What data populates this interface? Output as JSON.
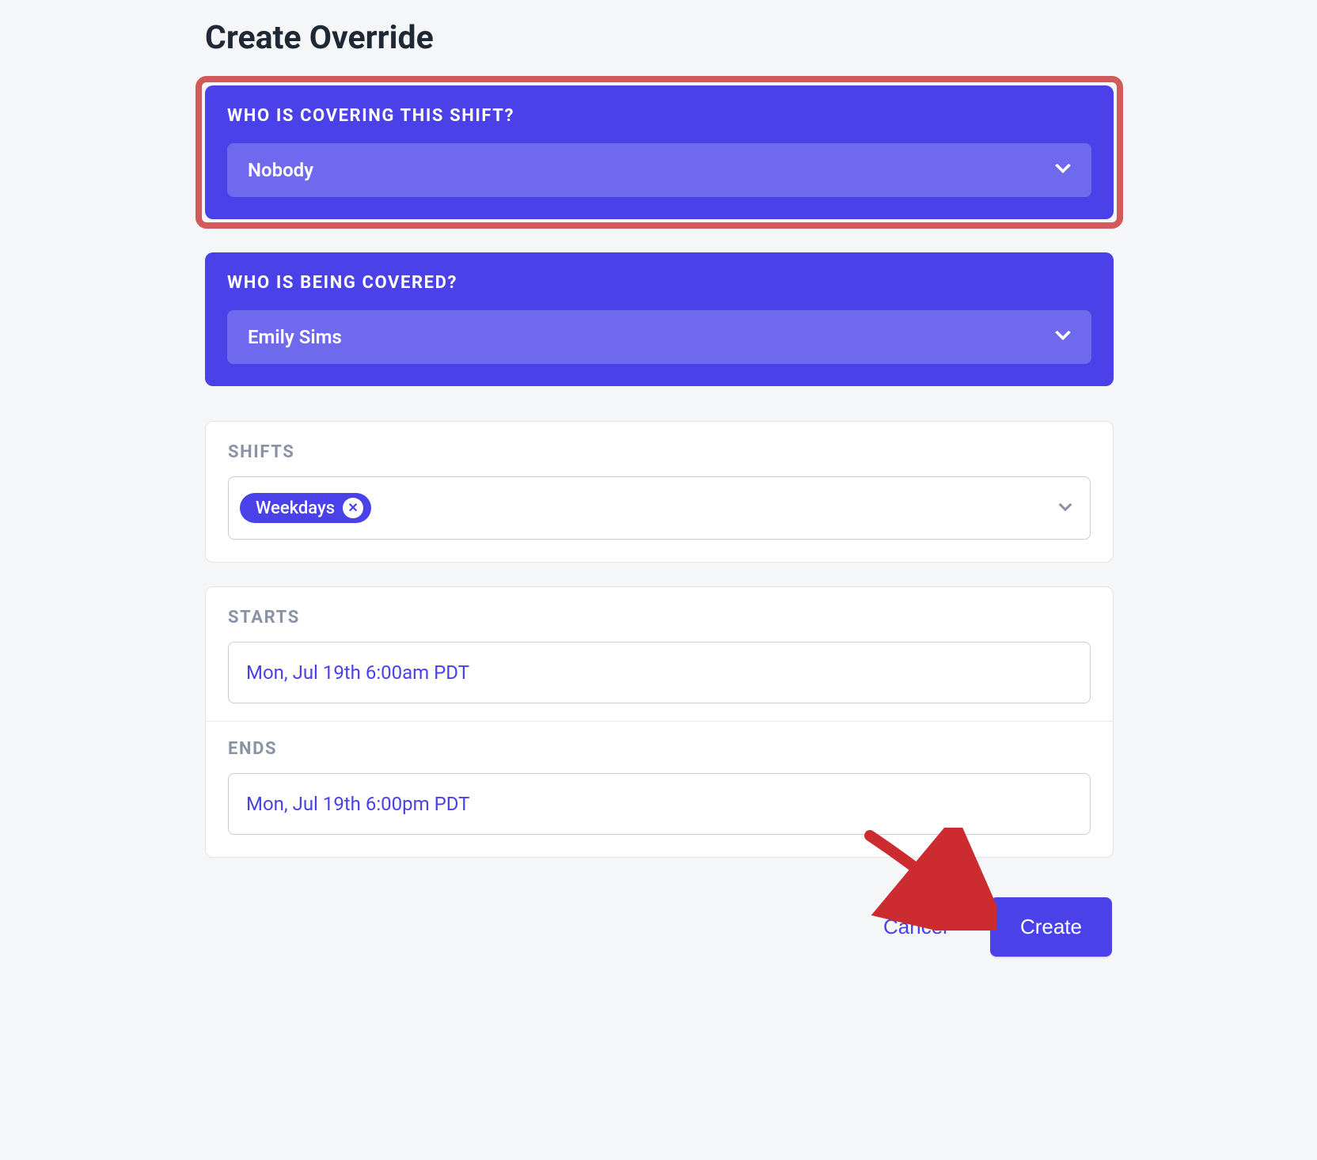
{
  "title": "Create Override",
  "sections": {
    "covering": {
      "label": "WHO IS COVERING THIS SHIFT?",
      "selected": "Nobody"
    },
    "covered": {
      "label": "WHO IS BEING COVERED?",
      "selected": "Emily Sims"
    },
    "shifts": {
      "label": "SHIFTS",
      "chips": [
        "Weekdays"
      ]
    },
    "starts": {
      "label": "STARTS",
      "value": "Mon, Jul 19th 6:00am PDT"
    },
    "ends": {
      "label": "ENDS",
      "value": "Mon, Jul 19th 6:00pm PDT"
    }
  },
  "actions": {
    "cancel": "Cancel",
    "create": "Create"
  },
  "colors": {
    "accent": "#4a42e8",
    "highlight_border": "#d15b5b",
    "arrow": "#cc2b30"
  }
}
